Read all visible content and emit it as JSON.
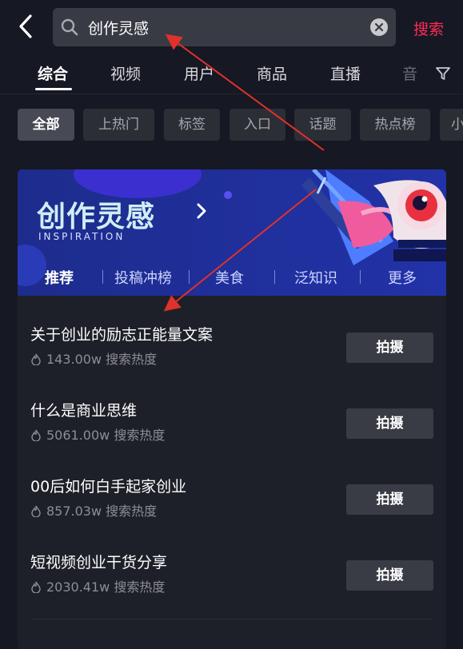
{
  "search": {
    "query": "创作灵感",
    "submit_label": "搜索"
  },
  "tabs": [
    {
      "label": "综合",
      "active": true
    },
    {
      "label": "视频"
    },
    {
      "label": "用户"
    },
    {
      "label": "商品"
    },
    {
      "label": "直播"
    },
    {
      "label": "音"
    }
  ],
  "chips": [
    {
      "label": "全部",
      "active": true
    },
    {
      "label": "上热门"
    },
    {
      "label": "标签"
    },
    {
      "label": "入口"
    },
    {
      "label": "话题"
    },
    {
      "label": "热点榜"
    },
    {
      "label": "小"
    }
  ],
  "inspiration": {
    "title": "创作灵感",
    "subtitle": "INSPIRATION",
    "tabs": [
      {
        "label": "推荐",
        "active": true
      },
      {
        "label": "投稿冲榜"
      },
      {
        "label": "美食"
      },
      {
        "label": "泛知识"
      },
      {
        "label": "更多"
      }
    ],
    "items": [
      {
        "title": "关于创业的励志正能量文案",
        "heat": "143.00w 搜索热度",
        "button": "拍摄"
      },
      {
        "title": "什么是商业思维",
        "heat": "5061.00w 搜索热度",
        "button": "拍摄"
      },
      {
        "title": "00后如何白手起家创业",
        "heat": "857.03w 搜索热度",
        "button": "拍摄"
      },
      {
        "title": "短视频创业干货分享",
        "heat": "2030.41w 搜索热度",
        "button": "拍摄"
      }
    ]
  },
  "colors": {
    "background": "#161823",
    "accent": "#fe2c55",
    "banner": "#1f2f8f",
    "annotation_arrow": "#e0312b"
  },
  "icons": [
    "back-arrow-icon",
    "search-icon",
    "clear-icon",
    "filter-icon",
    "chevron-right-icon",
    "flame-icon"
  ]
}
